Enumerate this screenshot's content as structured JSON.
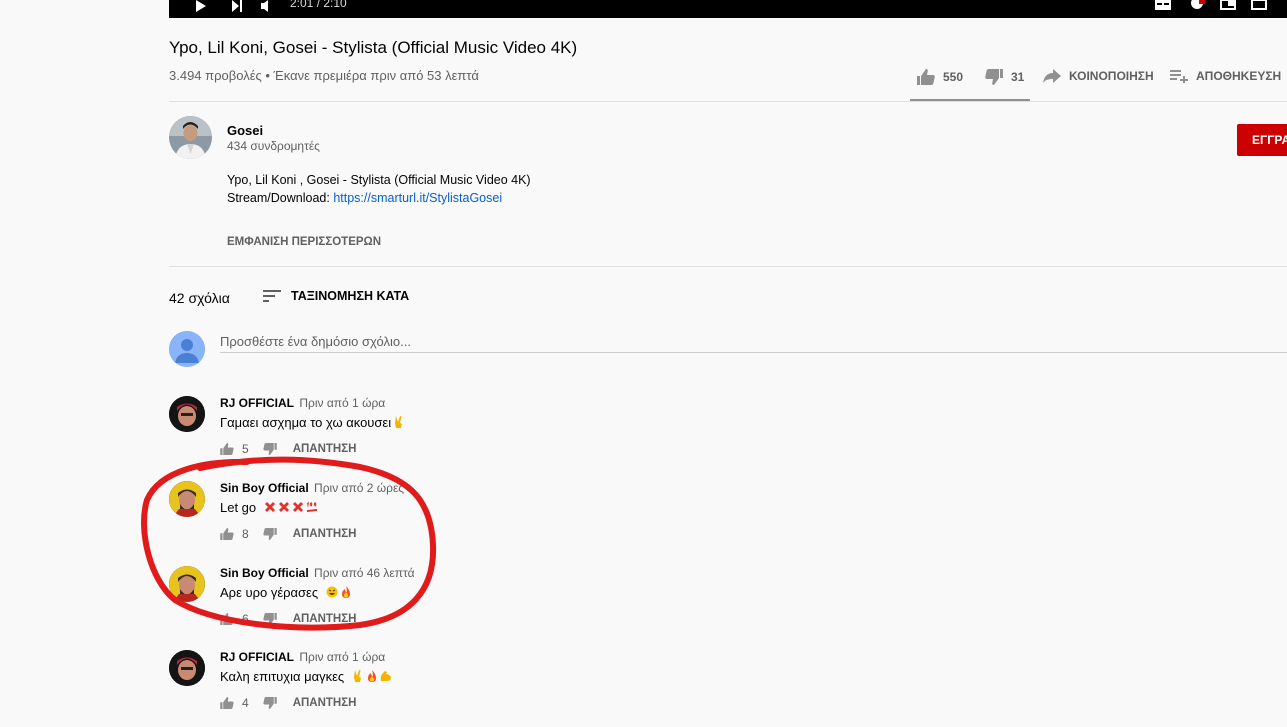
{
  "player": {
    "time": "2:01 / 2:10"
  },
  "video": {
    "title": "Ypo, Lil Koni, Gosei - Stylista (Official Music Video 4K)",
    "meta": "3.494 προβολές • Έκανε πρεμιέρα πριν από 53 λεπτά",
    "likes": "550",
    "dislikes": "31",
    "share_label": "ΚΟΙΝΟΠΟΙΗΣΗ",
    "save_label": "ΑΠΟΘΗΚΕΥΣΗ"
  },
  "channel": {
    "name": "Gosei",
    "subscribers": "434 συνδρομητές",
    "subscribe_label": "ΕΓΓΡΑ",
    "description_line1": "Ypo, Lil Koni , Gosei - Stylista (Official Music Video 4K)",
    "description_prefix": "Stream/Download: ",
    "description_link": "https://smarturl.it/StylistaGosei",
    "show_more": "ΕΜΦΑΝΙΣΗ ΠΕΡΙΣΣΟΤΕΡΩΝ"
  },
  "comments_header": {
    "count": "42 σχόλια",
    "sort_label": "ΤΑΞΙΝΟΜΗΣΗ ΚΑΤΑ",
    "placeholder": "Προσθέστε ένα δημόσιο σχόλιο..."
  },
  "comments": [
    {
      "author": "RJ OFFICIAL",
      "time": "Πριν από 1 ώρα",
      "text": "Γαμαει ασχημα το χω ακουσει",
      "likes": "5",
      "reply": "ΑΠΑΝΤΗΣΗ",
      "emojis": [
        "victory-hand"
      ]
    },
    {
      "author": "Sin Boy Official",
      "time": "Πριν από 2 ώρες",
      "text": "Let go",
      "likes": "8",
      "reply": "ΑΠΑΝΤΗΣΗ",
      "emojis": [
        "cross-mark",
        "cross-mark",
        "cross-mark",
        "hundred-points"
      ]
    },
    {
      "author": "Sin Boy Official",
      "time": "Πριν από 46 λεπτά",
      "text": "Αρε υρο γέρασες",
      "likes": "6",
      "reply": "ΑΠΑΝΤΗΣΗ",
      "emojis": [
        "laughing-face",
        "fire"
      ]
    },
    {
      "author": "RJ OFFICIAL",
      "time": "Πριν από 1 ώρα",
      "text": "Καλη επιτυχια μαγκες",
      "likes": "4",
      "reply": "ΑΠΑΝΤΗΣΗ",
      "emojis": [
        "victory-hand",
        "fire",
        "flexed-biceps"
      ]
    }
  ],
  "colors": {
    "subscribe": "#cc0000",
    "annotation": "#e01b1b",
    "link": "#065fd4"
  }
}
